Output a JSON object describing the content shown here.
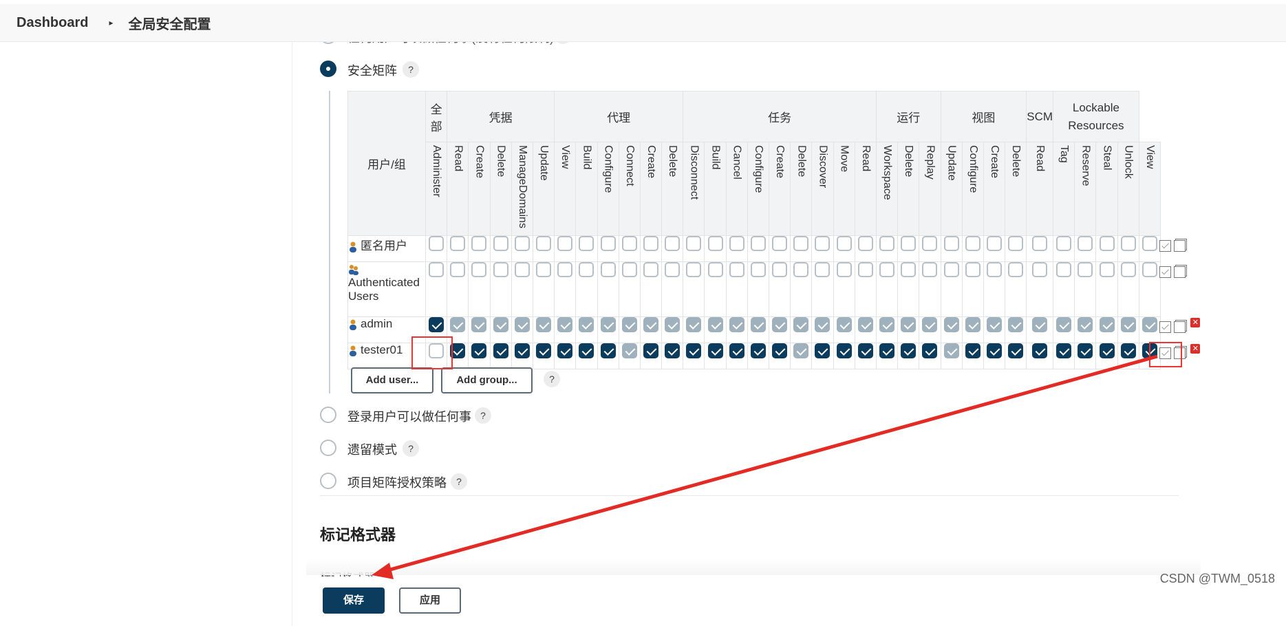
{
  "breadcrumb": {
    "items": [
      "Dashboard",
      "全局安全配置"
    ]
  },
  "auth": {
    "top_cut_option": "任何用户可以做任何事(没有任何限制)",
    "options": [
      {
        "label": "安全矩阵",
        "selected": true
      },
      {
        "label": "登录用户可以做任何事",
        "selected": false
      },
      {
        "label": "遗留模式",
        "selected": false
      },
      {
        "label": "项目矩阵授权策略",
        "selected": false
      }
    ],
    "help": "?"
  },
  "matrix": {
    "user_header": "用户/组",
    "groups": [
      {
        "label": "全部",
        "span": 1
      },
      {
        "label": "凭据",
        "span": 5
      },
      {
        "label": "代理",
        "span": 6
      },
      {
        "label": "任务",
        "span": 9
      },
      {
        "label": "运行",
        "span": 3
      },
      {
        "label": "视图",
        "span": 4
      },
      {
        "label": "SCM",
        "span": 1
      },
      {
        "label": "Lockable Resources",
        "span": 4
      }
    ],
    "permissions": [
      "Administer",
      "Read",
      "Create",
      "Delete",
      "ManageDomains",
      "Update",
      "View",
      "Build",
      "Configure",
      "Connect",
      "Create",
      "Delete",
      "Disconnect",
      "Build",
      "Cancel",
      "Configure",
      "Create",
      "Delete",
      "Discover",
      "Move",
      "Read",
      "Workspace",
      "Delete",
      "Replay",
      "Update",
      "Configure",
      "Create",
      "Delete",
      "Read",
      "Tag",
      "Reserve",
      "Steal",
      "Unlock",
      "View"
    ],
    "rows": [
      {
        "name": "匿名用户",
        "icon": "user-icon",
        "cells": "0000000000000000000000000000000000",
        "deletable": false
      },
      {
        "name": "Authenticated Users",
        "icon": "group-icon",
        "cells": "0000000000000000000000000000000000",
        "deletable": false
      },
      {
        "name": "admin",
        "icon": "user-icon",
        "cells": "1222222222222222222222222222222222",
        "deletable": true
      },
      {
        "name": "tester01",
        "icon": "user-icon",
        "cells": "0111111112111111121111112111111111",
        "deletable": true
      }
    ],
    "add_user": "Add user...",
    "add_group": "Add group..."
  },
  "markup": {
    "title": "标记格式器",
    "cut_label": "标记格式器"
  },
  "buttons": {
    "save": "保存",
    "apply": "应用"
  },
  "watermark": "CSDN @TWM_0518",
  "colors": {
    "primary": "#0b3c5d",
    "dim": "#9fb1bd",
    "annotation": "#e32b25"
  }
}
